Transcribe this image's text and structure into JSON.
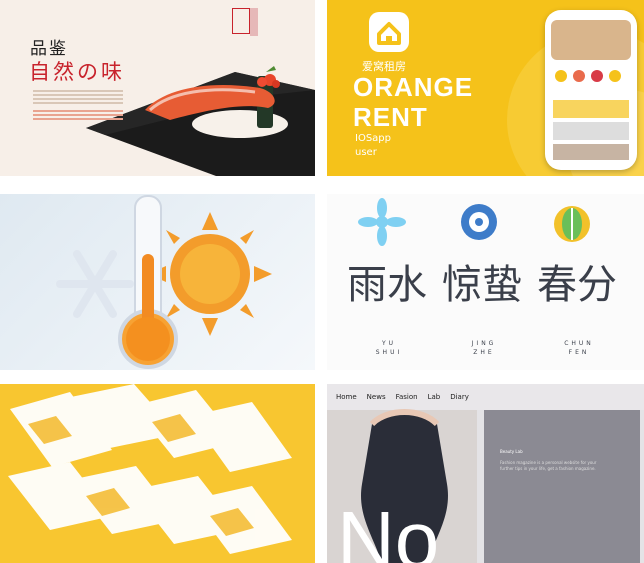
{
  "tiles": {
    "food": {
      "title_line1": "品鉴",
      "title_line2": "自然の味"
    },
    "orange_rent": {
      "cn_name": "爱窝租房",
      "title_line1": "ORANGE",
      "title_line2": "RENT",
      "subtitle1": "IOSapp",
      "subtitle2": "user"
    },
    "solar_terms": {
      "items": [
        {
          "char": "雨水",
          "pinyin1": "YU",
          "pinyin2": "SHUI"
        },
        {
          "char": "惊蛰",
          "pinyin1": "JING",
          "pinyin2": "ZHE"
        },
        {
          "char": "春分",
          "pinyin1": "CHUN",
          "pinyin2": "FEN"
        }
      ]
    },
    "fashion": {
      "nav": [
        "Home",
        "News",
        "Fasion",
        "Lab",
        "Diary"
      ],
      "section_title": "Beauty Lab",
      "paragraph": "Fashion magazine is a personal website for your further tips in your life, get a fashion magazine.",
      "big_text": "No"
    }
  },
  "colors": {
    "red": "#c8232c",
    "orange_yellow": "#f5c21a",
    "dark": "#3a3f4a"
  },
  "icons": {
    "home": "home-icon",
    "snowflake": "snowflake-icon",
    "sun": "sun-icon",
    "thermometer": "thermometer-icon"
  }
}
